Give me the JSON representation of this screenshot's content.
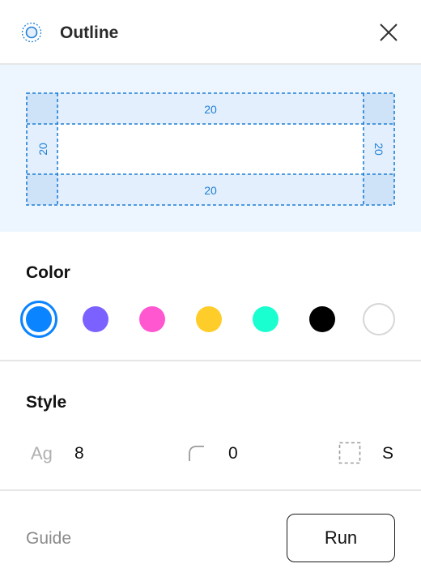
{
  "header": {
    "title": "Outline",
    "app_icon": "outline-target-icon",
    "close_icon": "close-icon"
  },
  "preview": {
    "padding_top": "20",
    "padding_bottom": "20",
    "padding_left": "20",
    "padding_right": "20",
    "accent": "#1f7fd6",
    "fill": "#e3effc",
    "background": "#edf5fe"
  },
  "color_section": {
    "title": "Color",
    "swatches": [
      {
        "name": "blue",
        "color": "#0a84ff",
        "selected": true
      },
      {
        "name": "purple",
        "color": "#7b61ff",
        "selected": false
      },
      {
        "name": "pink",
        "color": "#ff57d0",
        "selected": false
      },
      {
        "name": "yellow",
        "color": "#ffcd29",
        "selected": false
      },
      {
        "name": "teal",
        "color": "#1affd0",
        "selected": false
      },
      {
        "name": "black",
        "color": "#000000",
        "selected": false
      },
      {
        "name": "white",
        "color": "#ffffff",
        "selected": false
      }
    ]
  },
  "style_section": {
    "title": "Style",
    "font_icon_text": "Ag",
    "font_size": "8",
    "radius_icon": "corner-radius-icon",
    "radius": "0",
    "border_icon": "dashed-border-icon",
    "border_style": "S"
  },
  "footer": {
    "guide_label": "Guide",
    "run_label": "Run"
  }
}
